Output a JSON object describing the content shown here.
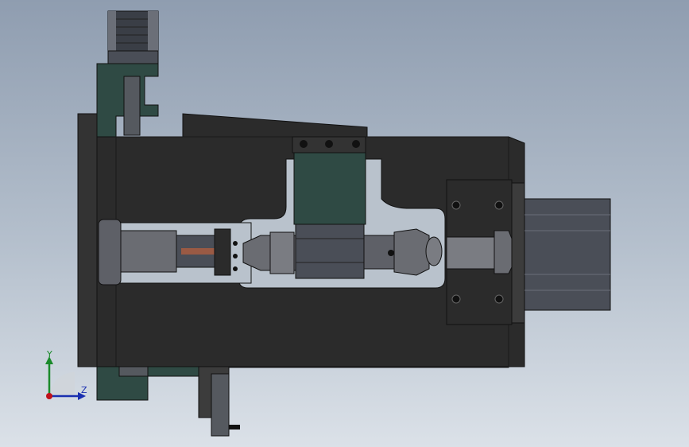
{
  "window": {
    "title": ""
  },
  "viewport": {
    "background_top": "#8f9db0",
    "background_bottom": "#dbe1e8"
  },
  "triad": {
    "y_label": "Y",
    "z_label": "Z",
    "y_color": "#1a8a2a",
    "z_color": "#1a2fb0",
    "x_color": "#c0101a"
  },
  "model": {
    "frame_color": "#2b2b2b",
    "plate_color": "#3c3c3c",
    "bracket_color": "#2f4a44",
    "motor_color": "#4a4e57",
    "cylinder_color": "#5e6067",
    "pin_color": "#9a5a44"
  }
}
